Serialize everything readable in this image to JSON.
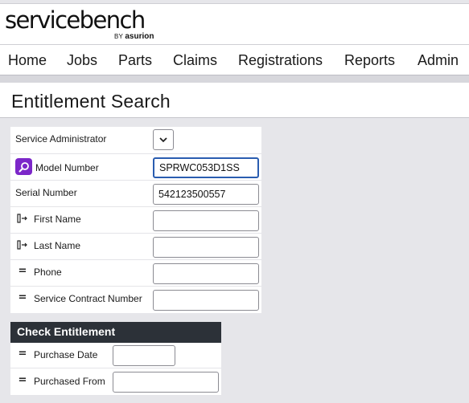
{
  "brand": {
    "logo_text": "servicebench",
    "by_text": "BY",
    "sub_brand": "asurion"
  },
  "nav": {
    "items": [
      "Home",
      "Jobs",
      "Parts",
      "Claims",
      "Registrations",
      "Reports",
      "Admin"
    ]
  },
  "page": {
    "title": "Entitlement Search"
  },
  "form": {
    "service_administrator": {
      "label": "Service Administrator",
      "value": ""
    },
    "model_number": {
      "label": "Model Number",
      "value": "SPRWC053D1SS",
      "icon": "search-icon"
    },
    "serial_number": {
      "label": "Serial Number",
      "value": "542123500557"
    },
    "first_name": {
      "label": "First Name",
      "value": "",
      "icon": "field-link-icon"
    },
    "last_name": {
      "label": "Last Name",
      "value": "",
      "icon": "field-link-icon"
    },
    "phone": {
      "label": "Phone",
      "value": "",
      "icon": "equals-icon"
    },
    "service_contract_number": {
      "label": "Service Contract Number",
      "value": "",
      "icon": "equals-icon"
    }
  },
  "check_entitlement": {
    "title": "Check Entitlement",
    "purchase_date": {
      "label": "Purchase Date",
      "value": "",
      "icon": "equals-icon"
    },
    "purchased_from": {
      "label": "Purchased From",
      "value": "",
      "icon": "equals-icon"
    }
  },
  "colors": {
    "accent_purple": "#7c27c9",
    "focus_blue": "#2a5db0",
    "section_header": "#2c3138"
  }
}
